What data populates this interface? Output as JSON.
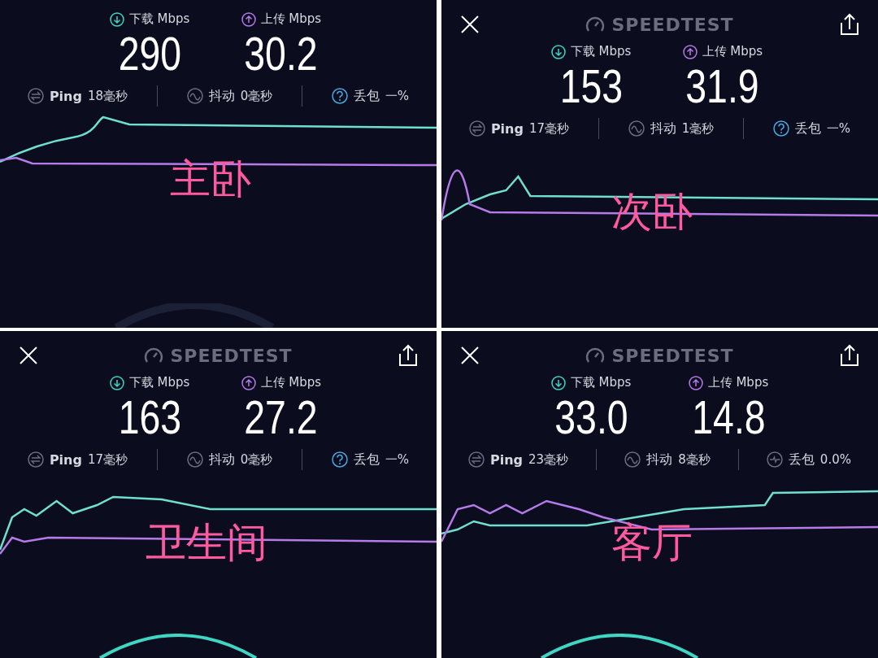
{
  "panels": [
    {
      "caption": "主卧",
      "download": {
        "label": "下载 Mbps",
        "value": "290"
      },
      "upload": {
        "label": "上传 Mbps",
        "value": "30.2"
      },
      "stats": [
        {
          "kind": "ping",
          "label": "Ping",
          "value": "18毫秒"
        },
        {
          "kind": "jitter",
          "label": "抖动",
          "value": "0毫秒"
        },
        {
          "kind": "loss_unknown",
          "label": "丢包",
          "value": "一%"
        }
      ]
    },
    {
      "header": {
        "title": "SPEEDTEST"
      },
      "caption": "次卧",
      "download": {
        "label": "下载 Mbps",
        "value": "153"
      },
      "upload": {
        "label": "上传 Mbps",
        "value": "31.9"
      },
      "stats": [
        {
          "kind": "ping",
          "label": "Ping",
          "value": "17毫秒"
        },
        {
          "kind": "jitter",
          "label": "抖动",
          "value": "1毫秒"
        },
        {
          "kind": "loss_unknown",
          "label": "丢包",
          "value": "一%"
        }
      ]
    },
    {
      "header": {
        "title": "SPEEDTEST"
      },
      "caption": "卫生间",
      "download": {
        "label": "下载 Mbps",
        "value": "163"
      },
      "upload": {
        "label": "上传 Mbps",
        "value": "27.2"
      },
      "stats": [
        {
          "kind": "ping",
          "label": "Ping",
          "value": "17毫秒"
        },
        {
          "kind": "jitter",
          "label": "抖动",
          "value": "0毫秒"
        },
        {
          "kind": "loss_unknown",
          "label": "丢包",
          "value": "一%"
        }
      ]
    },
    {
      "header": {
        "title": "SPEEDTEST"
      },
      "caption": "客厅",
      "download": {
        "label": "下载 Mbps",
        "value": "33.0"
      },
      "upload": {
        "label": "上传 Mbps",
        "value": "14.8"
      },
      "stats": [
        {
          "kind": "ping",
          "label": "Ping",
          "value": "23毫秒"
        },
        {
          "kind": "jitter",
          "label": "抖动",
          "value": "8毫秒"
        },
        {
          "kind": "loss",
          "label": "丢包",
          "value": "0.0%"
        }
      ]
    }
  ]
}
